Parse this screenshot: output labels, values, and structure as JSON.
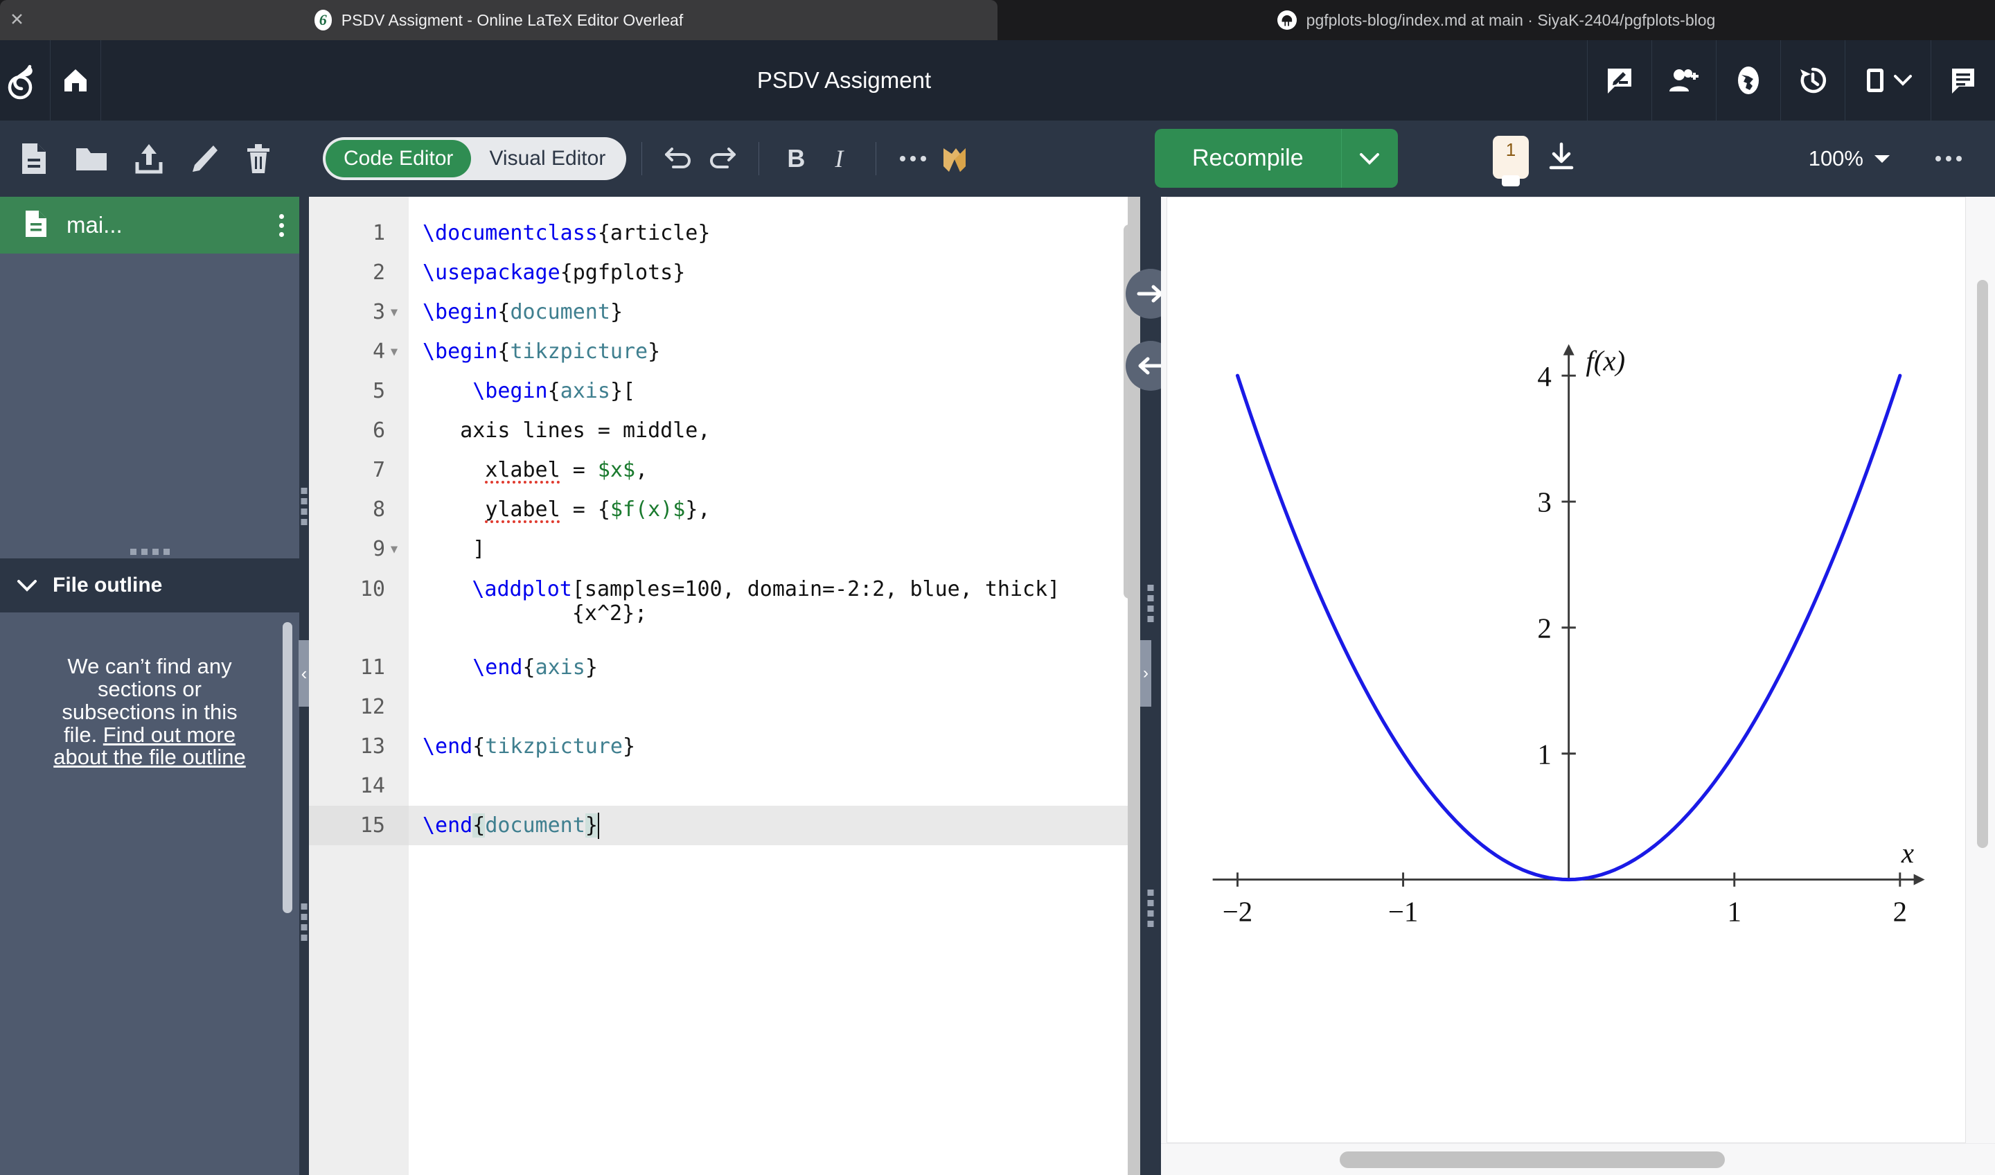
{
  "browser": {
    "tabs": [
      {
        "title": "PSDV Assigment - Online LaTeX Editor Overleaf",
        "favicon": "overleaf-favicon",
        "active": true,
        "close_label": "✕"
      },
      {
        "title": "pgfplots-blog/index.md at main · SiyaK-2404/pgfplots-blog",
        "favicon": "github-favicon",
        "active": false
      }
    ]
  },
  "topnav": {
    "logo": "overleaf-logo",
    "home_icon": "home-icon",
    "project_title": "PSDV Assigment",
    "actions": [
      {
        "name": "review-icon",
        "label": "Review"
      },
      {
        "name": "share-users-icon",
        "label": "Share"
      },
      {
        "name": "globe-icon",
        "label": "Submit"
      },
      {
        "name": "history-icon",
        "label": "History"
      },
      {
        "name": "layout-icon",
        "label": "Layout"
      },
      {
        "name": "chat-icon",
        "label": "Chat"
      }
    ]
  },
  "toolbar": {
    "file_actions": [
      {
        "name": "new-file-icon",
        "label": "New file"
      },
      {
        "name": "new-folder-icon",
        "label": "New folder"
      },
      {
        "name": "upload-icon",
        "label": "Upload"
      },
      {
        "name": "rename-pencil-icon",
        "label": "Rename"
      },
      {
        "name": "delete-trash-icon",
        "label": "Delete"
      }
    ],
    "editor_modes": [
      {
        "label": "Code Editor",
        "active": true
      },
      {
        "label": "Visual Editor",
        "active": false
      }
    ],
    "undo_label": "Undo",
    "redo_label": "Redo",
    "bold_label": "B",
    "italic_label": "I",
    "more_label": "More",
    "writefull_label": "Writefull",
    "recompile_label": "Recompile",
    "recompile_caret_label": "Recompile options",
    "warning_count": "1",
    "download_label": "Download PDF",
    "zoom_level": "100%",
    "preview_more_label": "More options",
    "accent_green": "#2f8d52",
    "warning_bg": "#fbf2e6",
    "warning_fg": "#8a5a13"
  },
  "sidebar": {
    "file": {
      "name": "mai...",
      "icon": "file-icon",
      "menu_label": "File options",
      "selected_bg": "#3a8554"
    },
    "outline": {
      "header": "File outline",
      "collapsed": false,
      "empty_text_1": "We can’t find any sections or subsections in this file. ",
      "empty_link": "Find out more about the file outline"
    }
  },
  "editor": {
    "active_line": 15,
    "lines": [
      {
        "n": "1",
        "fold": false,
        "tall": false,
        "tokens": [
          {
            "t": "\\documentclass",
            "c": "k-cmd"
          },
          {
            "t": "{article}",
            "c": ""
          }
        ]
      },
      {
        "n": "2",
        "fold": false,
        "tall": false,
        "tokens": [
          {
            "t": "\\usepackage",
            "c": "k-cmd"
          },
          {
            "t": "{pgfplots}",
            "c": ""
          }
        ]
      },
      {
        "n": "3",
        "fold": true,
        "tall": false,
        "tokens": [
          {
            "t": "\\begin",
            "c": "k-cmd"
          },
          {
            "t": "{",
            "c": ""
          },
          {
            "t": "document",
            "c": "k-env"
          },
          {
            "t": "}",
            "c": ""
          }
        ]
      },
      {
        "n": "4",
        "fold": true,
        "tall": false,
        "tokens": [
          {
            "t": "\\begin",
            "c": "k-cmd"
          },
          {
            "t": "{",
            "c": ""
          },
          {
            "t": "tikzpicture",
            "c": "k-env"
          },
          {
            "t": "}",
            "c": ""
          }
        ]
      },
      {
        "n": "5",
        "fold": false,
        "tall": false,
        "tokens": [
          {
            "t": "    ",
            "c": ""
          },
          {
            "t": "\\begin",
            "c": "k-cmd"
          },
          {
            "t": "{",
            "c": ""
          },
          {
            "t": "axis",
            "c": "k-env"
          },
          {
            "t": "}[",
            "c": ""
          }
        ]
      },
      {
        "n": "6",
        "fold": false,
        "tall": false,
        "tokens": [
          {
            "t": "   axis lines = middle,",
            "c": ""
          }
        ]
      },
      {
        "n": "7",
        "fold": false,
        "tall": false,
        "tokens": [
          {
            "t": "     ",
            "c": ""
          },
          {
            "t": "xlabel",
            "c": "spell"
          },
          {
            "t": " = ",
            "c": ""
          },
          {
            "t": "$x$",
            "c": "k-math"
          },
          {
            "t": ",",
            "c": ""
          }
        ]
      },
      {
        "n": "8",
        "fold": false,
        "tall": false,
        "tokens": [
          {
            "t": "     ",
            "c": ""
          },
          {
            "t": "ylabel",
            "c": "spell"
          },
          {
            "t": " = {",
            "c": ""
          },
          {
            "t": "$f(x)$",
            "c": "k-math"
          },
          {
            "t": "},",
            "c": ""
          }
        ]
      },
      {
        "n": "9",
        "fold": true,
        "tall": false,
        "tokens": [
          {
            "t": "    ]",
            "c": ""
          }
        ]
      },
      {
        "n": "10",
        "fold": false,
        "tall": true,
        "tokens": [
          {
            "t": "    ",
            "c": ""
          },
          {
            "t": "\\addplot",
            "c": "k-cmd"
          },
          {
            "t": "[samples=100, domain=-2:2, blue, thick] {x^2};",
            "c": ""
          }
        ]
      },
      {
        "n": "11",
        "fold": false,
        "tall": false,
        "tokens": [
          {
            "t": "    ",
            "c": ""
          },
          {
            "t": "\\end",
            "c": "k-cmd"
          },
          {
            "t": "{",
            "c": ""
          },
          {
            "t": "axis",
            "c": "k-env"
          },
          {
            "t": "}",
            "c": ""
          }
        ]
      },
      {
        "n": "12",
        "fold": false,
        "tall": false,
        "tokens": []
      },
      {
        "n": "13",
        "fold": false,
        "tall": false,
        "tokens": [
          {
            "t": "\\end",
            "c": "k-cmd"
          },
          {
            "t": "{",
            "c": ""
          },
          {
            "t": "tikzpicture",
            "c": "k-env"
          },
          {
            "t": "}",
            "c": ""
          }
        ]
      },
      {
        "n": "14",
        "fold": false,
        "tall": false,
        "tokens": []
      },
      {
        "n": "15",
        "fold": false,
        "tall": false,
        "hl": true,
        "tokens": [
          {
            "t": "\\end",
            "c": "k-cmd"
          },
          {
            "t": "{",
            "c": "brk"
          },
          {
            "t": "document",
            "c": "k-env"
          },
          {
            "t": "}",
            "c": "brk"
          }
        ]
      }
    ]
  },
  "chart_data": {
    "type": "line",
    "title": "",
    "xlabel": "x",
    "ylabel": "f(x)",
    "xlim": [
      -2.15,
      2.15
    ],
    "ylim": [
      0,
      4.25
    ],
    "xticks": [
      -2,
      -1,
      1,
      2
    ],
    "xtick_labels": [
      "−2",
      "−1",
      "1",
      "2"
    ],
    "yticks": [
      1,
      2,
      3,
      4
    ],
    "ytick_labels": [
      "1",
      "2",
      "3",
      "4"
    ],
    "grid": false,
    "axis_lines": "middle",
    "legend": null,
    "series": [
      {
        "name": "x^2",
        "color": "#1a1ae6",
        "thickness": "thick",
        "samples": 100,
        "domain": [
          -2,
          2
        ],
        "x": [
          -2,
          -1.8,
          -1.6,
          -1.4,
          -1.2,
          -1,
          -0.8,
          -0.6,
          -0.4,
          -0.2,
          0,
          0.2,
          0.4,
          0.6,
          0.8,
          1,
          1.2,
          1.4,
          1.6,
          1.8,
          2
        ],
        "y": [
          4,
          3.24,
          2.56,
          1.96,
          1.44,
          1,
          0.64,
          0.36,
          0.16,
          0.04,
          0,
          0.04,
          0.16,
          0.36,
          0.64,
          1,
          1.44,
          1.96,
          2.56,
          3.24,
          4
        ]
      }
    ]
  },
  "splitter": {
    "expand_right_label": "Expand preview",
    "expand_left_label": "Expand editor",
    "collapse_label": "‹"
  }
}
